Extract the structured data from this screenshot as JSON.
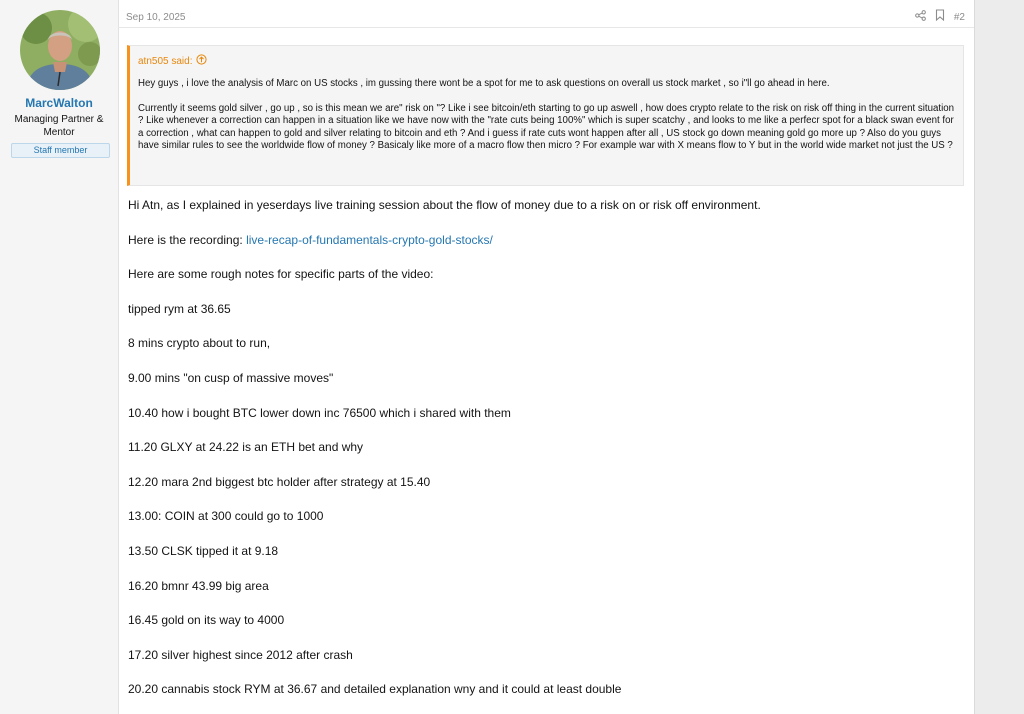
{
  "post": {
    "author": "MarcWalton",
    "author_title": "Managing Partner & Mentor",
    "badge": "Staff member",
    "date": "Sep 10, 2025",
    "number": "#2",
    "icons": [
      "share-icon",
      "bookmark-icon"
    ]
  },
  "quote": {
    "author": "atn505 said:",
    "icon": "arrow-up-circle-icon",
    "paragraphs": [
      "Hey guys , i love the analysis of Marc on US stocks , im gussing there wont be a spot for me to ask questions on overall us stock market , so i\"ll go ahead in here.",
      "Currently it seems gold silver , go up , so is this mean we are\" risk on \"? Like i see bitcoin/eth starting to go up aswell , how does crypto relate to the risk on risk off thing in the current situation ? Like whenever a correction can happen in a situation like we have now with the \"rate cuts being 100%\" which is super scatchy , and looks to me like a perfecr spot for a black swan event for a correction , what can happen to gold and silver relating to bitcoin and eth ? And i guess if rate cuts wont happen after all , US stock go down meaning gold go more up ? Also do you guys have similar rules to see the worldwide flow of money ? Basicaly like more of a macro flow then micro ? For example war with X means flow to Y but in the world wide market not just the US ?"
    ]
  },
  "body": {
    "intro": "Hi Atn, as I explained in yeserdays live training session about the flow of money due to a risk on or risk off environment.",
    "recording_prefix": "Here is the recording: ",
    "recording_link": "live-recap-of-fundamentals-crypto-gold-stocks/",
    "notes_intro": "Here are some rough notes for specific parts of the video:",
    "notes": [
      "tipped rym at 36.65",
      "8 mins crypto about to run,",
      "9.00 mins \"on cusp of massive moves\"",
      "10.40 how i bought BTC lower down inc 76500 which i shared with them",
      "11.20 GLXY at 24.22 is an ETH bet and why",
      "12.20 mara 2nd biggest btc holder after strategy at 15.40",
      "13.00: COIN at 300 could go to 1000",
      "13.50 CLSK tipped it at 9.18",
      "16.20 bmnr 43.99 big area",
      "16.45 gold on its way to 4000",
      "17.20 silver highest since 2012 after crash",
      "20.20 cannabis stock RYM at 36.67 and detailed explanation wny and it could at least double"
    ]
  },
  "colors": {
    "link": "#2577b1",
    "quote_accent": "#f7931d",
    "quote_author": "#e8870c"
  }
}
